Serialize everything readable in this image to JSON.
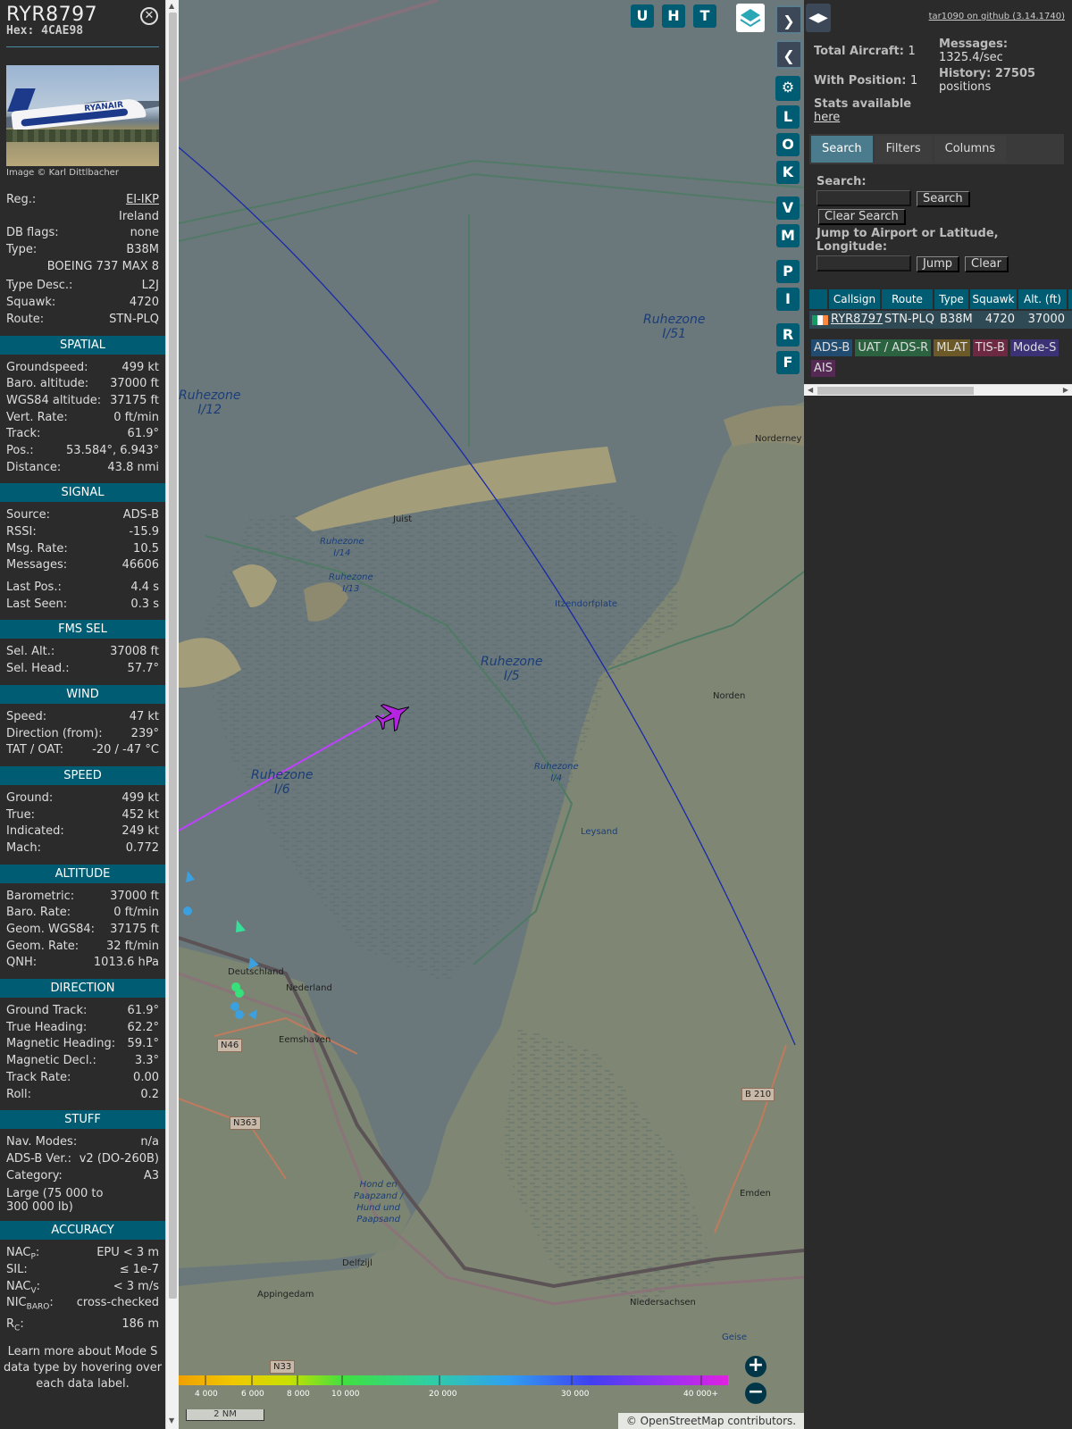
{
  "aircraft": {
    "callsign": "RYR8797",
    "hex": "Hex: 4CAE98",
    "image_credit": "Image © Karl Dittlbacher"
  },
  "basic": [
    {
      "label": "Reg.:",
      "value": "EI-IKP",
      "link": true
    },
    {
      "label": "",
      "value": "Ireland"
    },
    {
      "label": "DB flags:",
      "value": "none"
    },
    {
      "label": "Type:",
      "value": "B38M"
    },
    {
      "label": "",
      "value": "BOEING 737 MAX 8"
    },
    {
      "label": "Type Desc.:",
      "value": "L2J"
    },
    {
      "label": "Squawk:",
      "value": "4720"
    },
    {
      "label": "Route:",
      "value": "STN-PLQ"
    }
  ],
  "sections": [
    {
      "title": "SPATIAL",
      "rows": [
        [
          "Groundspeed:",
          "499 kt"
        ],
        [
          "Baro. altitude:",
          "37000 ft"
        ],
        [
          "WGS84 altitude:",
          "37175 ft"
        ],
        [
          "Vert. Rate:",
          "0 ft/min"
        ],
        [
          "Track:",
          "61.9°"
        ],
        [
          "Pos.:",
          "53.584°, 6.943°"
        ],
        [
          "Distance:",
          "43.8 nmi"
        ]
      ]
    },
    {
      "title": "SIGNAL",
      "rows": [
        [
          "Source:",
          "ADS-B"
        ],
        [
          "RSSI:",
          "-15.9"
        ],
        [
          "Msg. Rate:",
          "10.5"
        ],
        [
          "Messages:",
          "46606"
        ],
        [
          "Last Pos.:",
          "4.4 s"
        ],
        [
          "Last Seen:",
          "0.3 s"
        ]
      ]
    },
    {
      "title": "FMS SEL",
      "rows": [
        [
          "Sel. Alt.:",
          "37008 ft"
        ],
        [
          "Sel. Head.:",
          "57.7°"
        ]
      ]
    },
    {
      "title": "WIND",
      "rows": [
        [
          "Speed:",
          "47 kt"
        ],
        [
          "Direction (from):",
          "239°"
        ],
        [
          "TAT / OAT:",
          "-20 / -47 °C"
        ]
      ]
    },
    {
      "title": "SPEED",
      "rows": [
        [
          "Ground:",
          "499 kt"
        ],
        [
          "True:",
          "452 kt"
        ],
        [
          "Indicated:",
          "249 kt"
        ],
        [
          "Mach:",
          "0.772"
        ]
      ]
    },
    {
      "title": "ALTITUDE",
      "rows": [
        [
          "Barometric:",
          "37000 ft"
        ],
        [
          "Baro. Rate:",
          "0 ft/min"
        ],
        [
          "Geom. WGS84:",
          "37175 ft"
        ],
        [
          "Geom. Rate:",
          "32 ft/min"
        ],
        [
          "QNH:",
          "1013.6 hPa"
        ]
      ]
    },
    {
      "title": "DIRECTION",
      "rows": [
        [
          "Ground Track:",
          "61.9°"
        ],
        [
          "True Heading:",
          "62.2°"
        ],
        [
          "Magnetic Heading:",
          "59.1°"
        ],
        [
          "Magnetic Decl.:",
          "3.3°"
        ],
        [
          "Track Rate:",
          "0.00"
        ],
        [
          "Roll:",
          "0.2"
        ]
      ]
    },
    {
      "title": "STUFF",
      "rows": [
        [
          "Nav. Modes:",
          "n/a"
        ],
        [
          "ADS-B Ver.:",
          "v2 (DO-260B)"
        ],
        [
          "Category:",
          "A3"
        ]
      ],
      "extra": "Large (75 000 to 300 000 lb)"
    },
    {
      "title": "ACCURACY",
      "rows": [
        [
          "NACP:",
          "EPU < 3 m"
        ],
        [
          "SIL:",
          "≤ 1e-7"
        ],
        [
          "NACV:",
          "< 3 m/s"
        ],
        [
          "NICBARO:",
          "cross-checked"
        ],
        [
          "RC:",
          "186 m"
        ]
      ]
    }
  ],
  "accuracy_labels": [
    {
      "main": "NAC",
      "sub": "P"
    },
    {
      "main": "SIL",
      "sub": ""
    },
    {
      "main": "NAC",
      "sub": "V"
    },
    {
      "main": "NIC",
      "sub": "BARO"
    },
    {
      "main": "R",
      "sub": "C"
    }
  ],
  "footer_note": "Learn more about Mode S data type by hovering over each data label.",
  "map": {
    "top_buttons": [
      "U",
      "H",
      "T"
    ],
    "side_buttons": [
      "L",
      "O",
      "K",
      "V",
      "M",
      "P",
      "I",
      "R",
      "F"
    ],
    "labels": [
      {
        "t": "Ruhezone\nI/51"
      },
      {
        "t": "Ruhezone\nI/12"
      },
      {
        "t": "Norderney"
      },
      {
        "t": "Juist"
      },
      {
        "t": "Ruhezone\nI/14"
      },
      {
        "t": "Ruhezone\nI/13"
      },
      {
        "t": "Itzendorfplate"
      },
      {
        "t": "Ruhezone\nI/5"
      },
      {
        "t": "Norden"
      },
      {
        "t": "Ruhezone\nI/6"
      },
      {
        "t": "Ruhezone\nI/4"
      },
      {
        "t": "Leysand"
      },
      {
        "t": "Deutschland"
      },
      {
        "t": "Nederland"
      },
      {
        "t": "Eemshaven"
      },
      {
        "t": "N46"
      },
      {
        "t": "N363"
      },
      {
        "t": "B 210"
      },
      {
        "t": "Emden"
      },
      {
        "t": "Hond en\nPaapzand /\nHund und\nPaapsand"
      },
      {
        "t": "Delfzijl"
      },
      {
        "t": "Appingedam"
      },
      {
        "t": "Niedersachsen"
      },
      {
        "t": "Geise"
      },
      {
        "t": "N33"
      }
    ],
    "legend_ticks": [
      "4 000",
      "6 000",
      "8 000",
      "10 000",
      "20 000",
      "30 000",
      "40 000+"
    ],
    "scale": "2 NM",
    "attribution": "© OpenStreetMap contributors."
  },
  "right": {
    "version": "tar1090 on github (3.14.1740)",
    "total_label": "Total Aircraft:",
    "total": "1",
    "withpos_label": "With Position:",
    "withpos": "1",
    "stats_label": "Stats available",
    "stats_link": "here",
    "msgs_label": "Messages:",
    "msgs": "1325.4/sec",
    "hist_label": "History: 27505",
    "hist": "positions",
    "tabs": [
      "Search",
      "Filters",
      "Columns"
    ],
    "search_label": "Search:",
    "search_btn": "Search",
    "clear_search_btn": "Clear Search",
    "jump_label": "Jump to Airport or Latitude, Longitude:",
    "jump_btn": "Jump",
    "clear_btn": "Clear",
    "columns": [
      "Callsign",
      "Route",
      "Type",
      "Squawk",
      "Alt. (ft)"
    ],
    "row": {
      "callsign": "RYR8797",
      "route": "STN-PLQ",
      "type": "B38M",
      "squawk": "4720",
      "alt": "37000"
    },
    "chips": [
      {
        "t": "ADS-B",
        "bg": "#214c70"
      },
      {
        "t": "UAT / ADS-R",
        "bg": "#2b6340"
      },
      {
        "t": "MLAT",
        "bg": "#6b5a28"
      },
      {
        "t": "TIS-B",
        "bg": "#6d2842"
      },
      {
        "t": "Mode-S",
        "bg": "#3a3274"
      },
      {
        "t": "AIS",
        "bg": "#542a55"
      }
    ]
  }
}
